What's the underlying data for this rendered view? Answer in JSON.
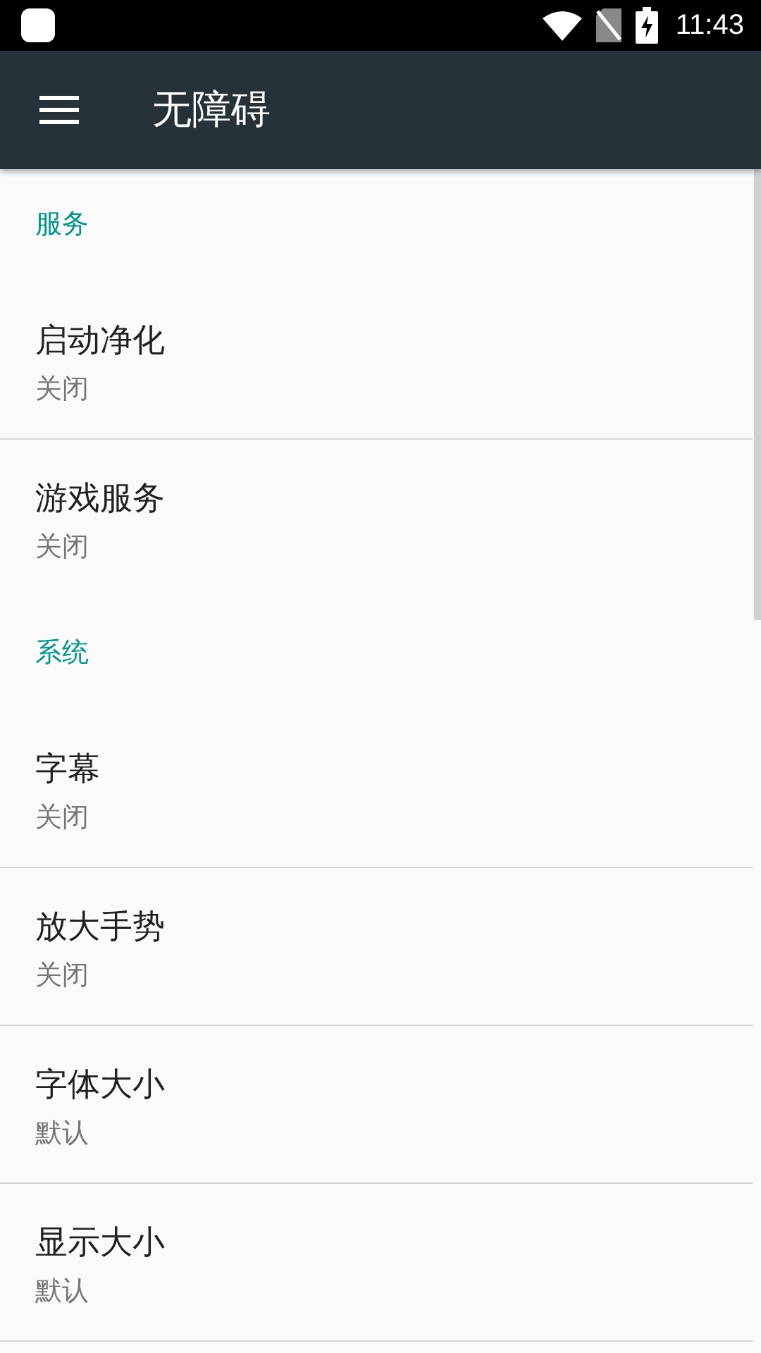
{
  "status_bar": {
    "time": "11:43"
  },
  "toolbar": {
    "title": "无障碍"
  },
  "sections": [
    {
      "title": "服务",
      "items": [
        {
          "title": "启动净化",
          "summary": "关闭"
        },
        {
          "title": "游戏服务",
          "summary": "关闭"
        }
      ]
    },
    {
      "title": "系统",
      "items": [
        {
          "title": "字幕",
          "summary": "关闭"
        },
        {
          "title": "放大手势",
          "summary": "关闭"
        },
        {
          "title": "字体大小",
          "summary": "默认"
        },
        {
          "title": "显示大小",
          "summary": "默认"
        }
      ]
    }
  ]
}
